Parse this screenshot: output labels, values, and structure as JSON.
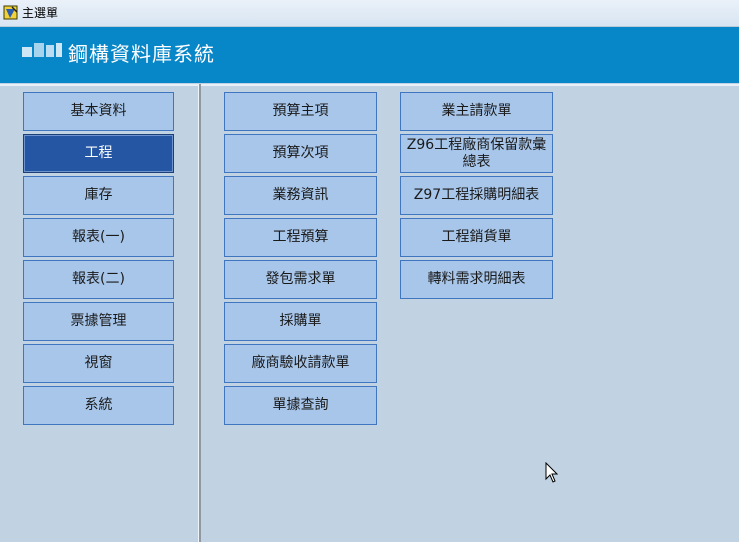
{
  "window": {
    "title": "主選單"
  },
  "header": {
    "title": "鋼構資料庫系統"
  },
  "menu": {
    "main_items": [
      {
        "label": "基本資料"
      },
      {
        "label": "工程"
      },
      {
        "label": "庫存"
      },
      {
        "label": "報表(一)"
      },
      {
        "label": "報表(二)"
      },
      {
        "label": "票據管理"
      },
      {
        "label": "視窗"
      },
      {
        "label": "系統"
      }
    ],
    "active_index": 1,
    "sub_col1": [
      {
        "label": "預算主項"
      },
      {
        "label": "預算次項"
      },
      {
        "label": "業務資訊"
      },
      {
        "label": "工程預算"
      },
      {
        "label": "發包需求單"
      },
      {
        "label": "採購單"
      },
      {
        "label": "廠商驗收請款單"
      },
      {
        "label": "單據查詢"
      }
    ],
    "sub_col2": [
      {
        "label": "業主請款單"
      },
      {
        "label": "Z96工程廠商保留款彙總表"
      },
      {
        "label": "Z97工程採購明細表"
      },
      {
        "label": "工程銷貨單"
      },
      {
        "label": "轉料需求明細表"
      }
    ]
  },
  "colors": {
    "header_bg": "#0786c8",
    "button_bg": "#a7c6ea",
    "button_active_bg": "#2456a4",
    "page_bg": "#c1d2e2"
  }
}
